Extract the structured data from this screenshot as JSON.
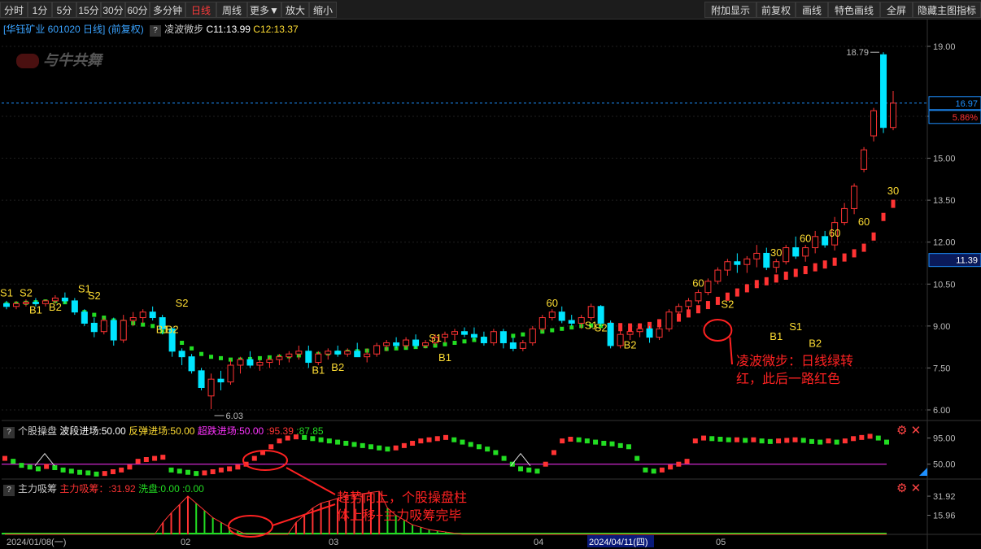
{
  "toolbar": {
    "left": [
      "分时",
      "1分",
      "5分",
      "15分",
      "30分",
      "60分",
      "多分钟",
      "日线",
      "周线",
      "更多▼",
      "放大",
      "缩小"
    ],
    "active": "日线",
    "right": [
      "附加显示",
      "前复权",
      "画线",
      "特色画线",
      "全屏",
      "隐藏主图指标"
    ]
  },
  "header": {
    "stock": "[华钰矿业 601020 日线]",
    "adjust": "(前复权)",
    "indicator": "凌波微步",
    "c1": "C11:13.99",
    "c2": "C12:13.37"
  },
  "watermark": "与牛共舞",
  "colors": {
    "up": "#ff3333",
    "down": "#00e5ff",
    "green": "#22dd22",
    "yellow": "#ffdd33",
    "magenta": "#ff33ff",
    "blue": "#1e90ff"
  },
  "pane1": {
    "axis_ticks": [
      "19.00",
      "16.50",
      "15.00",
      "13.50",
      "12.00",
      "10.50",
      "9.00",
      "7.50",
      "6.00"
    ],
    "price_tag": "16.97",
    "pct_tag": "5.86%",
    "stop_tag": "11.39",
    "high_label": "18.79",
    "low_label": "6.03",
    "annotation": [
      "凌波微步：日线绿转",
      "红，此后一路红色"
    ]
  },
  "pane2": {
    "name": "个股操盘",
    "items": [
      "波段进场:50.00",
      "反弹进场:50.00",
      "超跌进场:50.00",
      ":95.39",
      ":87.85"
    ],
    "axis_ticks": [
      "95.00",
      "50.00"
    ],
    "annotation": [
      "趋势向上，个股操盘柱",
      "体上移+主力吸筹完毕"
    ]
  },
  "pane3": {
    "name": "主力吸筹",
    "items": [
      "主力吸筹：:31.92",
      "洗盘:0.00",
      ":0.00"
    ],
    "axis_ticks": [
      "31.92",
      "15.96"
    ]
  },
  "x_axis": {
    "labels": [
      "2024/01/08(一)",
      "02",
      "03",
      "04",
      "2024/04/11(四)",
      "05"
    ]
  },
  "chart_data": [
    {
      "type": "candlestick",
      "title": "华钰矿业 601020 日线 (前复权)",
      "y_ticks": [
        19.0,
        16.5,
        15.0,
        13.5,
        12.0,
        10.5,
        9.0,
        7.5,
        6.0
      ],
      "ylim": [
        5.7,
        19.5
      ],
      "series": [
        {
          "name": "K线",
          "ohlc": [
            [
              9.8,
              9.9,
              9.6,
              9.7
            ],
            [
              9.7,
              9.9,
              9.6,
              9.8
            ],
            [
              9.8,
              9.95,
              9.7,
              9.85
            ],
            [
              9.85,
              10.0,
              9.7,
              9.8
            ],
            [
              9.8,
              9.95,
              9.7,
              9.9
            ],
            [
              9.9,
              10.1,
              9.8,
              10.0
            ],
            [
              10.0,
              10.2,
              9.8,
              9.9
            ],
            [
              9.9,
              10.0,
              9.4,
              9.5
            ],
            [
              9.5,
              9.6,
              9.0,
              9.1
            ],
            [
              9.1,
              9.3,
              8.6,
              8.8
            ],
            [
              8.8,
              9.3,
              8.7,
              9.2
            ],
            [
              9.2,
              9.3,
              8.3,
              8.5
            ],
            [
              8.5,
              9.4,
              8.4,
              9.2
            ],
            [
              9.2,
              9.5,
              9.0,
              9.3
            ],
            [
              9.3,
              9.6,
              9.1,
              9.5
            ],
            [
              9.5,
              9.7,
              9.2,
              9.3
            ],
            [
              9.3,
              9.4,
              8.7,
              8.9
            ],
            [
              8.9,
              8.95,
              7.9,
              8.1
            ],
            [
              8.1,
              8.2,
              7.6,
              7.9
            ],
            [
              7.9,
              8.0,
              7.3,
              7.4
            ],
            [
              7.4,
              7.5,
              6.7,
              6.8
            ],
            [
              6.5,
              7.3,
              6.03,
              7.1
            ],
            [
              7.1,
              7.4,
              6.7,
              7.0
            ],
            [
              7.0,
              7.8,
              6.9,
              7.6
            ],
            [
              7.6,
              7.9,
              7.3,
              7.8
            ],
            [
              7.8,
              8.1,
              7.5,
              7.6
            ],
            [
              7.6,
              7.8,
              7.4,
              7.7
            ],
            [
              7.7,
              7.9,
              7.5,
              7.8
            ],
            [
              7.8,
              8.0,
              7.6,
              7.9
            ],
            [
              7.9,
              8.1,
              7.7,
              8.0
            ],
            [
              8.0,
              8.3,
              7.8,
              8.1
            ],
            [
              8.1,
              8.3,
              7.5,
              7.7
            ],
            [
              7.7,
              8.1,
              7.6,
              8.0
            ],
            [
              8.0,
              8.2,
              7.8,
              8.1
            ],
            [
              8.1,
              8.3,
              7.9,
              8.0
            ],
            [
              8.0,
              8.2,
              7.9,
              8.1
            ],
            [
              8.1,
              8.4,
              8.0,
              7.9
            ],
            [
              7.9,
              8.2,
              7.7,
              8.0
            ],
            [
              8.0,
              8.4,
              7.9,
              8.3
            ],
            [
              8.3,
              8.5,
              8.1,
              8.4
            ],
            [
              8.4,
              8.6,
              8.2,
              8.3
            ],
            [
              8.3,
              8.6,
              8.2,
              8.5
            ],
            [
              8.5,
              8.7,
              8.2,
              8.3
            ],
            [
              8.3,
              8.5,
              8.2,
              8.4
            ],
            [
              8.4,
              8.7,
              8.3,
              8.6
            ],
            [
              8.6,
              8.8,
              8.4,
              8.7
            ],
            [
              8.7,
              8.9,
              8.5,
              8.8
            ],
            [
              8.8,
              8.95,
              8.6,
              8.7
            ],
            [
              8.7,
              8.95,
              8.5,
              8.6
            ],
            [
              8.6,
              8.8,
              8.3,
              8.4
            ],
            [
              8.4,
              8.9,
              8.3,
              8.8
            ],
            [
              8.8,
              8.9,
              8.2,
              8.4
            ],
            [
              8.4,
              8.6,
              8.1,
              8.2
            ],
            [
              8.2,
              8.5,
              8.1,
              8.4
            ],
            [
              8.4,
              9.0,
              8.3,
              8.9
            ],
            [
              8.9,
              9.4,
              8.8,
              9.3
            ],
            [
              9.3,
              9.6,
              9.2,
              9.5
            ],
            [
              9.5,
              9.7,
              9.1,
              9.2
            ],
            [
              9.2,
              9.4,
              9.0,
              9.1
            ],
            [
              9.1,
              9.4,
              8.9,
              9.3
            ],
            [
              9.3,
              9.8,
              9.2,
              9.7
            ],
            [
              9.7,
              9.75,
              9.0,
              9.1
            ],
            [
              9.1,
              9.2,
              8.2,
              8.3
            ],
            [
              8.3,
              8.9,
              8.2,
              8.7
            ],
            [
              8.7,
              9.0,
              8.5,
              8.8
            ],
            [
              8.8,
              9.1,
              8.6,
              8.9
            ],
            [
              8.9,
              9.0,
              8.4,
              8.6
            ],
            [
              8.6,
              9.0,
              8.5,
              8.9
            ],
            [
              8.9,
              9.6,
              8.8,
              9.5
            ],
            [
              9.5,
              9.8,
              9.3,
              9.7
            ],
            [
              9.7,
              10.0,
              9.5,
              9.9
            ],
            [
              9.9,
              10.3,
              9.8,
              10.2
            ],
            [
              10.2,
              10.7,
              10.1,
              10.6
            ],
            [
              10.6,
              11.1,
              10.5,
              11.0
            ],
            [
              11.0,
              11.4,
              10.8,
              11.3
            ],
            [
              11.3,
              11.6,
              10.9,
              11.2
            ],
            [
              11.2,
              11.5,
              10.9,
              11.4
            ],
            [
              11.4,
              11.9,
              11.1,
              11.6
            ],
            [
              11.6,
              11.8,
              11.0,
              11.1
            ],
            [
              11.1,
              11.4,
              10.9,
              11.3
            ],
            [
              11.3,
              11.9,
              11.2,
              11.8
            ],
            [
              11.8,
              12.2,
              11.4,
              11.5
            ],
            [
              11.5,
              11.9,
              11.3,
              11.8
            ],
            [
              11.8,
              12.4,
              11.6,
              12.2
            ],
            [
              12.2,
              12.4,
              11.8,
              11.9
            ],
            [
              11.9,
              12.9,
              11.7,
              12.7
            ],
            [
              12.7,
              13.4,
              12.6,
              13.2
            ],
            [
              13.2,
              14.1,
              13.0,
              14.0
            ],
            [
              14.6,
              15.4,
              14.5,
              15.3
            ],
            [
              15.8,
              16.8,
              15.6,
              16.7
            ],
            [
              18.7,
              18.79,
              15.9,
              16.1
            ],
            [
              16.1,
              17.4,
              16.0,
              16.97
            ]
          ]
        },
        {
          "name": "凌波微步",
          "values": [
            9.75,
            9.78,
            9.8,
            9.83,
            9.85,
            9.88,
            9.9,
            9.85,
            9.6,
            9.5,
            9.4,
            9.3,
            9.2,
            9.15,
            9.1,
            9.05,
            9.0,
            8.8,
            8.6,
            8.4,
            8.2,
            8.0,
            7.9,
            7.85,
            7.8,
            7.8,
            7.82,
            7.85,
            7.88,
            7.9,
            7.92,
            7.95,
            7.98,
            8.0,
            8.02,
            8.05,
            8.08,
            8.1,
            8.12,
            8.15,
            8.18,
            8.2,
            8.22,
            8.25,
            8.28,
            8.3,
            8.35,
            8.4,
            8.45,
            8.5,
            8.55,
            8.58,
            8.6,
            8.65,
            8.7,
            8.75,
            8.8,
            8.85,
            8.9,
            8.95,
            9.0,
            9.02,
            9.0,
            8.98,
            8.96,
            8.95,
            8.95,
            9.0,
            9.1,
            9.2,
            9.3,
            9.45,
            9.6,
            9.75,
            9.9,
            10.05,
            10.2,
            10.35,
            10.5,
            10.6,
            10.7,
            10.8,
            10.9,
            11.0,
            11.1,
            11.2,
            11.3,
            11.45,
            11.6,
            11.8,
            12.2,
            12.9,
            13.37
          ]
        }
      ]
    },
    {
      "type": "bar",
      "title": "个股操盘",
      "y_ticks": [
        95.0,
        50.0
      ],
      "ylim": [
        30,
        100
      ],
      "series": [
        {
          "name": "个股操盘",
          "values": [
            60,
            55,
            48,
            45,
            42,
            46,
            44,
            40,
            38,
            36,
            35,
            33,
            34,
            37,
            40,
            45,
            55,
            58,
            60,
            62,
            40,
            38,
            36,
            34,
            35,
            37,
            40,
            42,
            45,
            50,
            60,
            70,
            80,
            90,
            95,
            97,
            96,
            94,
            92,
            90,
            88,
            86,
            84,
            82,
            80,
            78,
            76,
            78,
            82,
            86,
            90,
            92,
            94,
            96,
            92,
            88,
            84,
            80,
            76,
            70,
            60,
            50,
            42,
            40,
            38,
            50,
            70,
            90,
            93,
            92,
            90,
            88,
            86,
            85,
            82,
            80,
            60,
            40,
            38,
            40,
            45,
            50,
            55,
            90,
            95,
            94,
            93,
            92,
            92,
            91,
            92,
            90,
            89,
            90,
            91,
            92,
            91,
            89,
            88,
            90,
            88,
            90,
            94,
            96,
            98,
            95,
            88
          ]
        }
      ]
    },
    {
      "type": "bar",
      "title": "主力吸筹",
      "y_ticks": [
        31.92,
        15.96
      ],
      "ylim": [
        0,
        35
      ],
      "series": [
        {
          "name": "主力吸筹",
          "values": [
            0,
            0,
            0,
            0,
            0,
            0,
            0,
            0,
            0,
            0,
            0,
            0,
            0,
            0,
            0,
            0,
            0,
            0,
            0,
            10,
            18,
            25,
            32,
            26,
            20,
            14,
            10,
            6,
            3,
            0,
            0,
            0,
            0,
            0,
            0,
            10,
            16,
            22,
            26,
            28,
            30,
            32,
            33,
            34,
            35,
            36,
            22,
            16,
            12,
            8,
            6,
            4,
            3,
            2,
            1,
            0,
            0,
            0,
            0,
            0,
            0,
            0,
            0,
            0,
            0,
            0,
            0,
            0,
            0,
            0,
            0,
            0,
            0,
            0,
            0,
            0,
            0,
            0,
            0,
            0,
            0,
            0,
            0,
            0,
            0,
            0,
            0,
            0,
            0,
            0,
            0,
            0,
            0,
            0,
            0,
            0,
            0,
            0,
            0,
            0,
            0,
            0,
            0,
            0,
            0,
            0,
            0
          ]
        }
      ]
    }
  ]
}
